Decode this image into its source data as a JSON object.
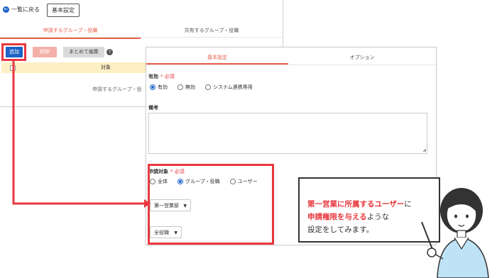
{
  "back_window": {
    "back_link": "一覧に戻る",
    "basic_settings_button": "基本設定",
    "tabs": [
      "申請するグループ・役職",
      "共有するグループ・役職"
    ],
    "toolbar": {
      "add": "追加",
      "delete": "削除",
      "bulk_edit": "まとめて編集",
      "help": "?"
    },
    "table": {
      "column": "対象",
      "empty_text": "申請するグループ・役"
    }
  },
  "front_window": {
    "tabs": [
      "基本設定",
      "オプション"
    ],
    "valid": {
      "label": "有効",
      "required": "* 必須",
      "options": [
        "有効",
        "無効",
        "システム連携専用"
      ],
      "selected": "有効"
    },
    "notes": {
      "label": "備考",
      "value": ""
    },
    "target": {
      "label": "申請対象",
      "required": "* 必須",
      "options": [
        "全体",
        "グループ・役職",
        "ユーザー"
      ],
      "selected": "グループ・役職",
      "group_select": "第一営業部",
      "position_select": "全役職"
    }
  },
  "callout": {
    "line1_highlight": "第一営業に所属するユーザー",
    "line1_rest": "に",
    "line2_highlight": "申請権限を与える",
    "line2_rest": "ような",
    "line3": "設定をしてみます。"
  },
  "colors": {
    "accent": "#e8604c",
    "primary": "#1d63c8",
    "highlight": "#e8383e"
  }
}
